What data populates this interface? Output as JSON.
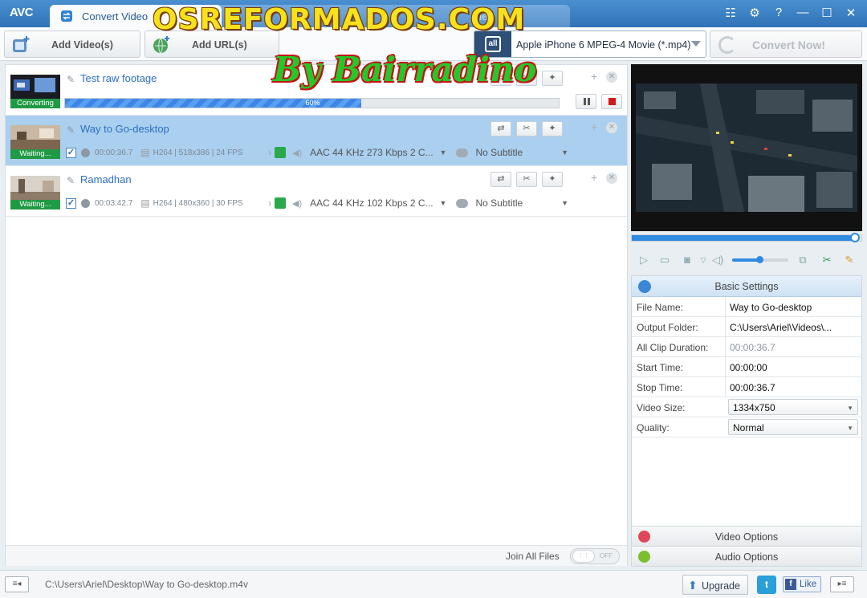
{
  "app": {
    "logo": "AVC"
  },
  "tabs": [
    {
      "label": "Convert Video"
    },
    {
      "label": "ideo"
    }
  ],
  "window_controls": [
    "☷",
    "⚙",
    "?",
    "—",
    "☐",
    "✕"
  ],
  "toolbar": {
    "add_video_label": "Add Video(s)",
    "add_url_label": "Add URL(s)",
    "format_icon_text": "all",
    "format_value": "Apple iPhone 6 MPEG-4 Movie (*.mp4)",
    "convert_label": "Convert Now!"
  },
  "watermark": {
    "line1": "OSREFORMADOS.COM",
    "line2": "By Bairradino"
  },
  "items": [
    {
      "name": "Test raw footage",
      "status": "Converting",
      "progress_percent": 60,
      "progress_text": "60%",
      "selected": false
    },
    {
      "name": "Way to Go-desktop",
      "status": "Waiting...",
      "duration": "00:00:36.7",
      "video_info": "H264 | 518x386 | 24 FPS",
      "audio": "AAC 44 KHz 273 Kbps 2 C...",
      "subtitle": "No Subtitle",
      "selected": true
    },
    {
      "name": "Ramadhan",
      "status": "Waiting...",
      "duration": "00:03:42.7",
      "video_info": "H264 | 480x360 | 30 FPS",
      "audio": "AAC 44 KHz 102 Kbps 2 C...",
      "subtitle": "No Subtitle",
      "selected": false
    }
  ],
  "join": {
    "label": "Join All Files",
    "toggle_text": "OFF"
  },
  "preview": {
    "seek_fraction": 0.96,
    "volume_fraction": 0.5
  },
  "settings": {
    "header": "Basic Settings",
    "rows": [
      {
        "label": "File Name:",
        "value": "Way to Go-desktop"
      },
      {
        "label": "Output Folder:",
        "value": "C:\\Users\\Ariel\\Videos\\..."
      },
      {
        "label": "All Clip Duration:",
        "value": "00:00:36.7"
      },
      {
        "label": "Start Time:",
        "value": "00:00:00"
      },
      {
        "label": "Stop Time:",
        "value": "00:00:36.7"
      },
      {
        "label": "Video Size:",
        "value": "1334x750"
      },
      {
        "label": "Quality:",
        "value": "Normal"
      }
    ],
    "video_options": "Video Options",
    "audio_options": "Audio Options"
  },
  "statusbar": {
    "path": "C:\\Users\\Ariel\\Desktop\\Way to Go-desktop.m4v",
    "upgrade": "Upgrade",
    "like": "Like"
  },
  "colors": {
    "accent": "#2f8ae0",
    "selected_row": "#aacfef",
    "status_green": "#1f9a44"
  }
}
